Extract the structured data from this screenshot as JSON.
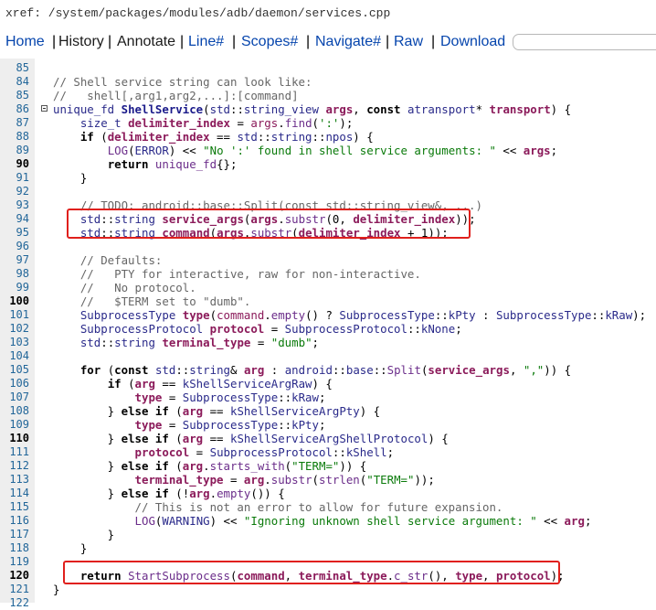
{
  "title": "xref: /system/packages/modules/adb/daemon/services.cpp",
  "nav": {
    "home": "Home",
    "history": "History",
    "annotate": "Annotate",
    "line": "Line#",
    "scopes": "Scopes#",
    "navigate": "Navigate#",
    "raw": "Raw",
    "download": "Download",
    "sep": "|",
    "search_placeholder": ""
  },
  "colors": {
    "link": "#0645ad",
    "highlight_box": "#e0201c",
    "line_number": "#226699",
    "comment": "#666666",
    "string": "#0a7a0a"
  },
  "code_lines": [
    {
      "n": "85",
      "bold": false,
      "html": ""
    },
    {
      "n": "84",
      "bold": false,
      "html": "<span class=\"c\">// Shell service string can look like:</span>"
    },
    {
      "n": "85",
      "bold": false,
      "html": "<span class=\"c\">//   shell[,arg1,arg2,...]:[command]</span>"
    },
    {
      "n": "86",
      "bold": false,
      "fold": true,
      "html": "<span class=\"t\">unique_fd</span> <span class=\"f\" style=\"font-weight:bold;color:#1a1a8a\">ShellService</span>(<span class=\"t\">std</span>::<span class=\"t\">string_view</span> <span class=\"v\">args</span>, <span class=\"k\">const</span> <span class=\"t\">atransport</span>* <span class=\"v\">transport</span>) {"
    },
    {
      "n": "87",
      "bold": false,
      "html": "    <span class=\"t\">size_t</span> <span class=\"v\">delimiter_index</span> = <span class=\"v\" style=\"font-weight:normal\">args</span>.<span class=\"f\">find</span>(<span class=\"s\">':'</span>);"
    },
    {
      "n": "88",
      "bold": false,
      "html": "    <span class=\"k\">if</span> (<span class=\"v\">delimiter_index</span> == <span class=\"t\">std</span>::<span class=\"t\">string</span>::<span class=\"t\">npos</span>) {"
    },
    {
      "n": "89",
      "bold": false,
      "html": "        <span class=\"f\">LOG</span>(<span class=\"t\">ERROR</span>) &lt;&lt; <span class=\"s\">\"No ':' found in shell service arguments: \"</span> &lt;&lt; <span class=\"v\">args</span>;"
    },
    {
      "n": "90",
      "bold": true,
      "html": "        <span class=\"k\">return</span> <span class=\"f\">unique_fd</span>{};"
    },
    {
      "n": "91",
      "bold": false,
      "html": "    }"
    },
    {
      "n": "92",
      "bold": false,
      "html": ""
    },
    {
      "n": "93",
      "bold": false,
      "html": "    <span class=\"c\">// TODO: android::base::Split(const std::string_view&amp;, ...)</span>"
    },
    {
      "n": "94",
      "bold": false,
      "html": "    <span class=\"t\">std</span>::<span class=\"t\">string</span> <span class=\"v\">service_args</span>(<span class=\"v\">args</span>.<span class=\"f\">substr</span>(0, <span class=\"v\">delimiter_index</span>));"
    },
    {
      "n": "95",
      "bold": false,
      "html": "    <span class=\"t\">std</span>::<span class=\"t\">string</span> <span class=\"v\">command</span>(<span class=\"v\">args</span>.<span class=\"f\">substr</span>(<span class=\"v\">delimiter_index</span> + 1));"
    },
    {
      "n": "96",
      "bold": false,
      "html": ""
    },
    {
      "n": "97",
      "bold": false,
      "html": "    <span class=\"c\">// Defaults:</span>"
    },
    {
      "n": "98",
      "bold": false,
      "html": "    <span class=\"c\">//   PTY for interactive, raw for non-interactive.</span>"
    },
    {
      "n": "99",
      "bold": false,
      "html": "    <span class=\"c\">//   No protocol.</span>"
    },
    {
      "n": "100",
      "bold": true,
      "html": "    <span class=\"c\">//   $TERM set to \"dumb\".</span>"
    },
    {
      "n": "101",
      "bold": false,
      "html": "    <span class=\"t\">SubprocessType</span> <span class=\"v\">type</span>(<span class=\"v\" style=\"font-weight:normal\">command</span>.<span class=\"f\">empty</span>() ? <span class=\"t\">SubprocessType</span>::<span class=\"t\">kPty</span> : <span class=\"t\">SubprocessType</span>::<span class=\"t\">kRaw</span>);"
    },
    {
      "n": "102",
      "bold": false,
      "html": "    <span class=\"t\">SubprocessProtocol</span> <span class=\"v\">protocol</span> = <span class=\"t\">SubprocessProtocol</span>::<span class=\"t\">kNone</span>;"
    },
    {
      "n": "103",
      "bold": false,
      "html": "    <span class=\"t\">std</span>::<span class=\"t\">string</span> <span class=\"v\">terminal_type</span> = <span class=\"s\">\"dumb\"</span>;"
    },
    {
      "n": "104",
      "bold": false,
      "html": ""
    },
    {
      "n": "105",
      "bold": false,
      "html": "    <span class=\"k\">for</span> (<span class=\"k\">const</span> <span class=\"t\">std</span>::<span class=\"t\">string</span>&amp; <span class=\"v\">arg</span> : <span class=\"t\">android</span>::<span class=\"t\">base</span>::<span class=\"f\">Split</span>(<span class=\"v\">service_args</span>, <span class=\"s\">\",\"</span>)) {"
    },
    {
      "n": "106",
      "bold": false,
      "html": "        <span class=\"k\">if</span> (<span class=\"v\">arg</span> == <span class=\"t\">kShellServiceArgRaw</span>) {"
    },
    {
      "n": "107",
      "bold": false,
      "html": "            <span class=\"v\">type</span> = <span class=\"t\">SubprocessType</span>::<span class=\"t\">kRaw</span>;"
    },
    {
      "n": "108",
      "bold": false,
      "html": "        } <span class=\"k\">else if</span> (<span class=\"v\">arg</span> == <span class=\"t\">kShellServiceArgPty</span>) {"
    },
    {
      "n": "109",
      "bold": false,
      "html": "            <span class=\"v\">type</span> = <span class=\"t\">SubprocessType</span>::<span class=\"t\">kPty</span>;"
    },
    {
      "n": "110",
      "bold": true,
      "html": "        } <span class=\"k\">else if</span> (<span class=\"v\">arg</span> == <span class=\"t\">kShellServiceArgShellProtocol</span>) {"
    },
    {
      "n": "111",
      "bold": false,
      "html": "            <span class=\"v\">protocol</span> = <span class=\"t\">SubprocessProtocol</span>::<span class=\"t\">kShell</span>;"
    },
    {
      "n": "112",
      "bold": false,
      "html": "        } <span class=\"k\">else if</span> (<span class=\"v\">arg</span>.<span class=\"f\">starts_with</span>(<span class=\"s\">\"TERM=\"</span>)) {"
    },
    {
      "n": "113",
      "bold": false,
      "html": "            <span class=\"v\">terminal_type</span> = <span class=\"v\">arg</span>.<span class=\"f\">substr</span>(<span class=\"f\">strlen</span>(<span class=\"s\">\"TERM=\"</span>));"
    },
    {
      "n": "114",
      "bold": false,
      "html": "        } <span class=\"k\">else if</span> (!<span class=\"v\">arg</span>.<span class=\"f\">empty</span>()) {"
    },
    {
      "n": "115",
      "bold": false,
      "html": "            <span class=\"c\">// This is not an error to allow for future expansion.</span>"
    },
    {
      "n": "116",
      "bold": false,
      "html": "            <span class=\"f\">LOG</span>(<span class=\"t\">WARNING</span>) &lt;&lt; <span class=\"s\">\"Ignoring unknown shell service argument: \"</span> &lt;&lt; <span class=\"v\">arg</span>;"
    },
    {
      "n": "117",
      "bold": false,
      "html": "        }"
    },
    {
      "n": "118",
      "bold": false,
      "html": "    }"
    },
    {
      "n": "119",
      "bold": false,
      "html": ""
    },
    {
      "n": "120",
      "bold": true,
      "html": "    <span class=\"k\">return</span> <span class=\"f\">StartSubprocess</span>(<span class=\"v\">command</span>, <span class=\"v\">terminal_type</span>.<span class=\"f\">c_str</span>(), <span class=\"v\">type</span>, <span class=\"v\">protocol</span>);"
    },
    {
      "n": "121",
      "bold": false,
      "html": "}"
    },
    {
      "n": "122",
      "bold": false,
      "html": ""
    }
  ]
}
